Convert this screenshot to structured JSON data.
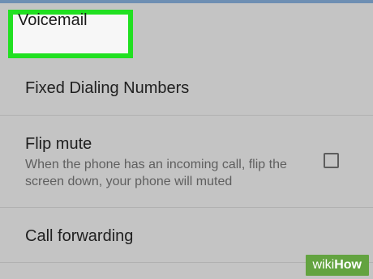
{
  "settings": {
    "voicemail_label": "Voicemail",
    "fixed_dialing_label": "Fixed Dialing Numbers",
    "flip_mute": {
      "label": "Flip mute",
      "summary": "When the phone has an incoming call, flip the screen down, your phone will muted",
      "checked": false
    },
    "call_forwarding_label": "Call forwarding"
  },
  "watermark": {
    "text_small": "wiki",
    "text_bold": "How"
  },
  "colors": {
    "background": "#c4c4c4",
    "highlight": "#21e021",
    "watermark": "#63a340"
  }
}
